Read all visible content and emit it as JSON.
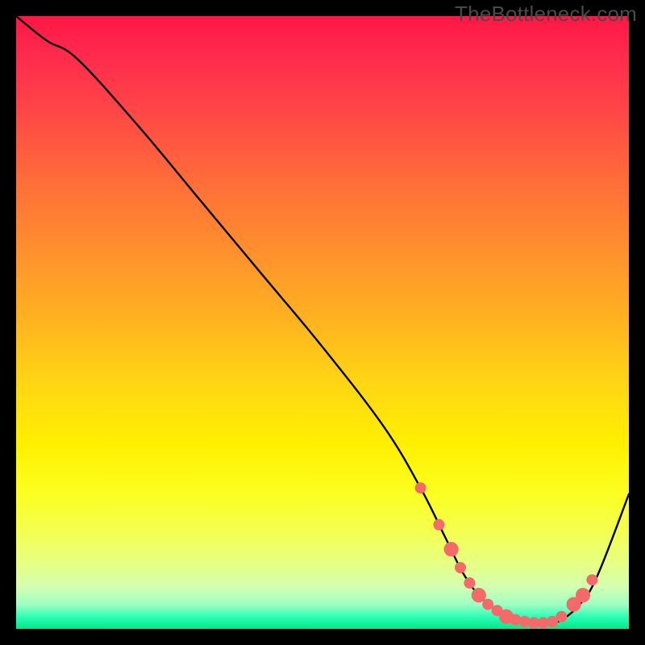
{
  "watermark": "TheBottleneck.com",
  "chart_data": {
    "type": "line",
    "title": "",
    "xlabel": "",
    "ylabel": "",
    "xlim": [
      0,
      100
    ],
    "ylim": [
      0,
      100
    ],
    "series": [
      {
        "name": "curve",
        "x": [
          0,
          5,
          10,
          20,
          30,
          40,
          50,
          60,
          66,
          70,
          73,
          76,
          80,
          84,
          88,
          92,
          95,
          100
        ],
        "values": [
          100,
          96,
          93,
          82,
          70,
          58,
          46,
          33,
          23,
          15,
          9,
          5,
          2,
          1,
          1,
          4,
          9,
          22
        ]
      }
    ],
    "markers": {
      "name": "highlighted-points",
      "color": "#f46a6a",
      "points": [
        {
          "x": 66,
          "y": 23,
          "r": 1.0
        },
        {
          "x": 69,
          "y": 17,
          "r": 1.0
        },
        {
          "x": 71,
          "y": 13,
          "r": 1.3
        },
        {
          "x": 72.5,
          "y": 10,
          "r": 1.0
        },
        {
          "x": 74,
          "y": 7.5,
          "r": 1.0
        },
        {
          "x": 75.5,
          "y": 5.5,
          "r": 1.3
        },
        {
          "x": 77,
          "y": 4,
          "r": 1.0
        },
        {
          "x": 78.5,
          "y": 3,
          "r": 1.0
        },
        {
          "x": 80,
          "y": 2,
          "r": 1.3
        },
        {
          "x": 81.5,
          "y": 1.5,
          "r": 1.0
        },
        {
          "x": 83,
          "y": 1.2,
          "r": 1.0
        },
        {
          "x": 84.5,
          "y": 1,
          "r": 1.0
        },
        {
          "x": 86,
          "y": 1,
          "r": 1.0
        },
        {
          "x": 87.5,
          "y": 1.2,
          "r": 1.0
        },
        {
          "x": 89,
          "y": 2,
          "r": 1.0
        },
        {
          "x": 91,
          "y": 4,
          "r": 1.3
        },
        {
          "x": 92.5,
          "y": 5.5,
          "r": 1.3
        },
        {
          "x": 94,
          "y": 8,
          "r": 1.0
        }
      ]
    }
  }
}
